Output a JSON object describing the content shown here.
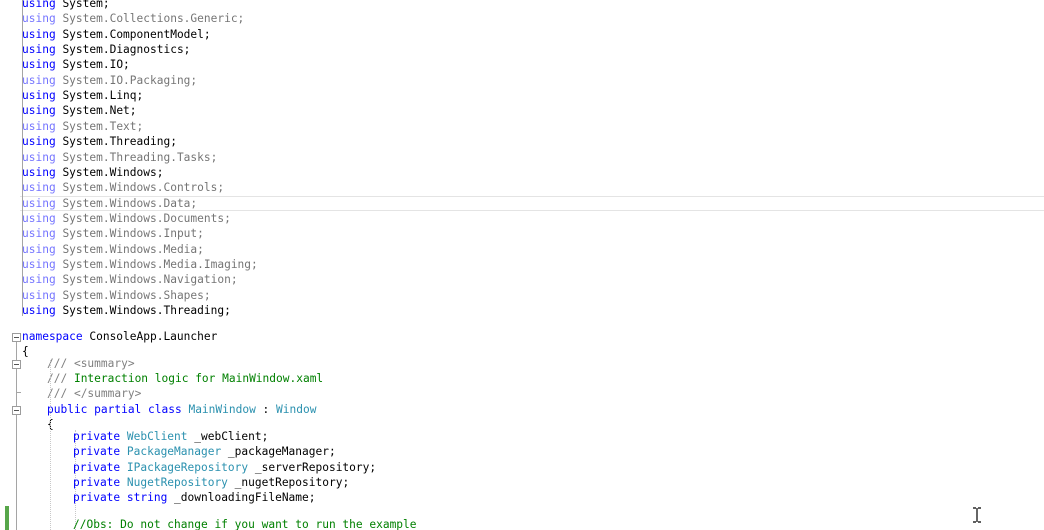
{
  "editor": {
    "usings": [
      {
        "ns": "System;",
        "used": true
      },
      {
        "ns": "System.Collections.Generic;",
        "used": false
      },
      {
        "ns": "System.ComponentModel;",
        "used": true
      },
      {
        "ns": "System.Diagnostics;",
        "used": true
      },
      {
        "ns": "System.IO;",
        "used": true
      },
      {
        "ns": "System.IO.Packaging;",
        "used": false
      },
      {
        "ns": "System.Linq;",
        "used": true
      },
      {
        "ns": "System.Net;",
        "used": true
      },
      {
        "ns": "System.Text;",
        "used": false
      },
      {
        "ns": "System.Threading;",
        "used": true
      },
      {
        "ns": "System.Threading.Tasks;",
        "used": false
      },
      {
        "ns": "System.Windows;",
        "used": true
      },
      {
        "ns": "System.Windows.Controls;",
        "used": false
      },
      {
        "ns": "System.Windows.Data;",
        "used": false
      },
      {
        "ns": "System.Windows.Documents;",
        "used": false
      },
      {
        "ns": "System.Windows.Input;",
        "used": false
      },
      {
        "ns": "System.Windows.Media;",
        "used": false
      },
      {
        "ns": "System.Windows.Media.Imaging;",
        "used": false
      },
      {
        "ns": "System.Windows.Navigation;",
        "used": false
      },
      {
        "ns": "System.Windows.Shapes;",
        "used": false
      },
      {
        "ns": "System.Windows.Threading;",
        "used": true
      }
    ],
    "using_keyword": "using",
    "namespace_keyword": "namespace",
    "namespace_name": " ConsoleApp.Launcher",
    "open_brace": "{",
    "doc_prefix": "/// ",
    "doc_summary_open": "<summary>",
    "doc_text": "Interaction logic for MainWindow.xaml",
    "doc_summary_close": "</summary>",
    "class_modifiers": "public partial class ",
    "class_name": "MainWindow",
    "class_colon": " : ",
    "base_class": "Window",
    "fields": [
      {
        "modifier": "private ",
        "type": "WebClient",
        "type_is_keyword": false,
        "name": " _webClient;"
      },
      {
        "modifier": "private ",
        "type": "PackageManager",
        "type_is_keyword": false,
        "name": " _packageManager;"
      },
      {
        "modifier": "private ",
        "type": "IPackageRepository",
        "type_is_keyword": false,
        "name": " _serverRepository;"
      },
      {
        "modifier": "private ",
        "type": "NugetRepository",
        "type_is_keyword": false,
        "name": " _nugetRepository;"
      },
      {
        "modifier": "private ",
        "type": "string",
        "type_is_keyword": true,
        "name": " _downloadingFileName;"
      }
    ],
    "partial_comment": "//Obs: Do not change if you want to run the example"
  },
  "colors": {
    "keyword": "#0000ff",
    "type": "#2b91af",
    "comment": "#008000",
    "doc_tag": "#808080",
    "change_bar": "#57a64a"
  },
  "icons": [
    "collapse-icon",
    "text-cursor-icon"
  ]
}
